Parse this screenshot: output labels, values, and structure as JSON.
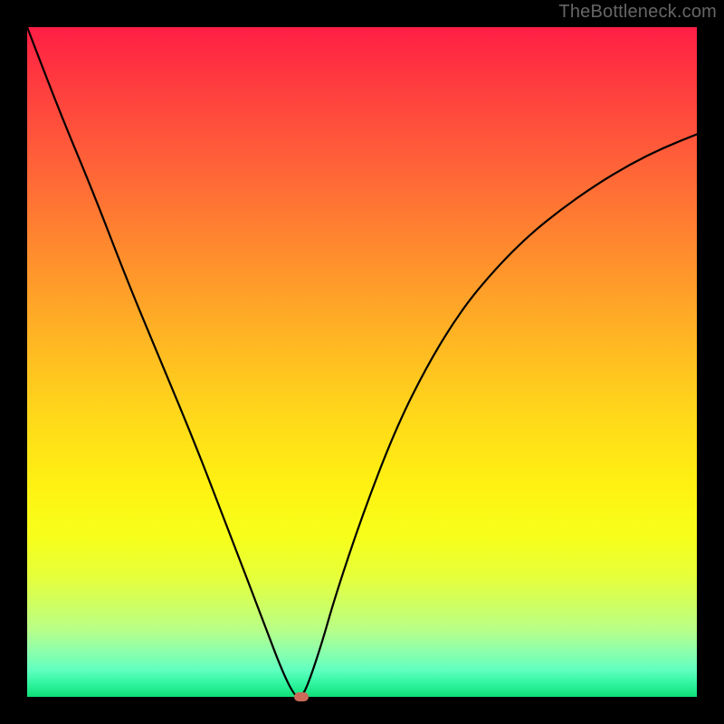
{
  "watermark": "TheBottleneck.com",
  "colors": {
    "curve_stroke": "#000000",
    "marker_fill": "#cc6a5a",
    "frame_bg": "#000000"
  },
  "chart_data": {
    "type": "line",
    "title": "",
    "xlabel": "",
    "ylabel": "",
    "xlim": [
      0,
      100
    ],
    "ylim": [
      0,
      100
    ],
    "grid": false,
    "legend": false,
    "x": [
      0,
      5,
      10,
      15,
      20,
      25,
      30,
      35,
      38,
      40,
      41,
      42,
      44,
      46,
      50,
      55,
      60,
      65,
      70,
      75,
      80,
      85,
      90,
      95,
      100
    ],
    "values": [
      100,
      87,
      75,
      62,
      50,
      38,
      25,
      12,
      4,
      0,
      0,
      2,
      8,
      15,
      27,
      40,
      50,
      58,
      64,
      69,
      73,
      76.5,
      79.5,
      82,
      84
    ],
    "marker": {
      "x": 41,
      "y": 0
    },
    "notes": "V-shaped bottleneck curve; y is bottleneck % (0 at optimum near x≈41). Values estimated from pixel heights."
  }
}
